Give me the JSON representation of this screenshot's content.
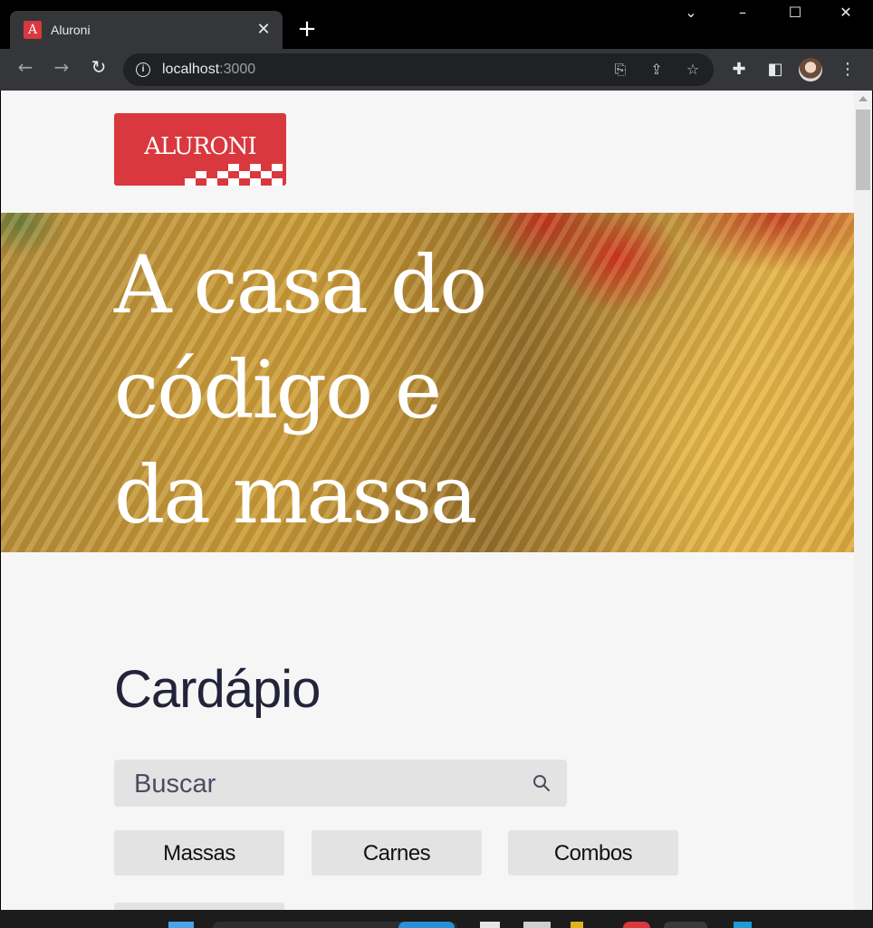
{
  "browser": {
    "tab_title": "Aluroni",
    "favicon_letter": "A",
    "url_host": "localhost",
    "url_port": ":3000"
  },
  "page": {
    "logo_text": "ALURONI",
    "hero_title": "A casa do código e da massa",
    "menu_title": "Cardápio",
    "search_placeholder": "Buscar",
    "filters": [
      "Massas",
      "Carnes",
      "Combos"
    ]
  },
  "colors": {
    "brand_red": "#d9383e",
    "title_dark": "#23243a",
    "filter_bg": "#e3e3e3",
    "page_bg": "#f6f6f6"
  }
}
